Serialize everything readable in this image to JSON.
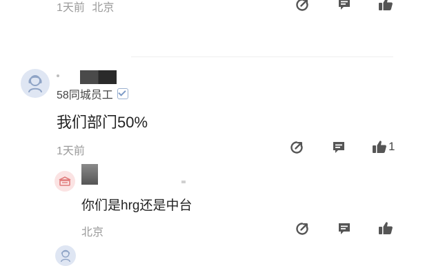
{
  "top_comment": {
    "time": "1天前",
    "location": "北京"
  },
  "comment": {
    "user_title": "58同城员工",
    "text": "我们部门50%",
    "time": "1天前",
    "like_count": "1"
  },
  "reply": {
    "text": "你们是hrg还是中台",
    "location": "北京"
  },
  "icons": {
    "share": "share-icon",
    "reply": "comment-icon",
    "like": "thumbs-up-icon",
    "verified": "verified-badge-icon"
  },
  "colors": {
    "background": "#ffffff",
    "meta_text": "#9a9a9a",
    "icon": "#555555",
    "avatar_bg": "#dfe6f3"
  }
}
